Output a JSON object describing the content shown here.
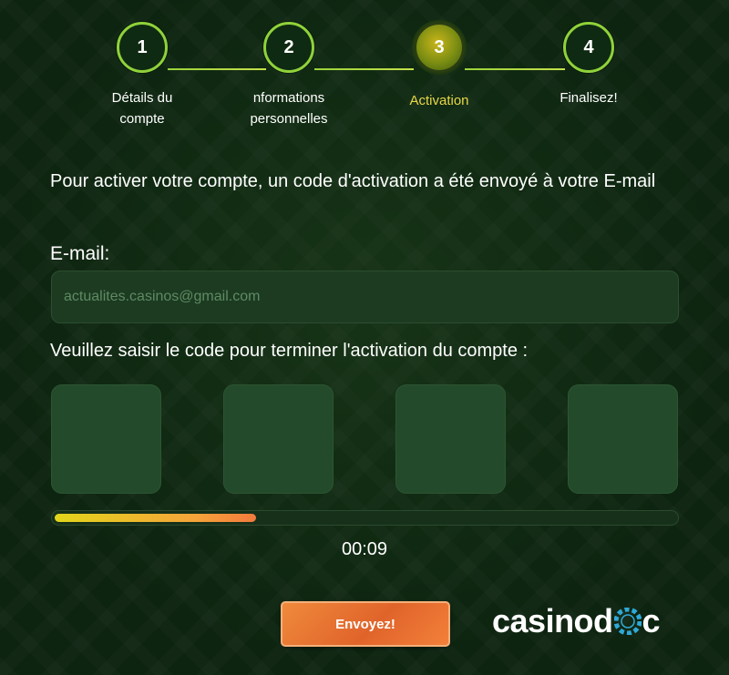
{
  "stepper": {
    "steps": [
      {
        "number": "1",
        "label_line1": "Détails du",
        "label_line2": "compte",
        "state": "completed"
      },
      {
        "number": "2",
        "label_line1": "nformations",
        "label_line2": "personnelles",
        "state": "completed"
      },
      {
        "number": "3",
        "label_line1": "Activation",
        "label_line2": "",
        "state": "active"
      },
      {
        "number": "4",
        "label_line1": "Finalisez!",
        "label_line2": "",
        "state": "pending"
      }
    ]
  },
  "intro_text": "Pour activer votre compte, un code d'activation a été envoyé à votre E-mail",
  "email": {
    "label": "E-mail:",
    "value": "actualites.casinos@gmail.com"
  },
  "code": {
    "label": "Veuillez saisir le code pour terminer l'activation du compte :",
    "digits": [
      "",
      "",
      "",
      ""
    ]
  },
  "countdown": {
    "time": "00:09",
    "remaining_fraction": 0.33
  },
  "submit_label": "Envoyez!",
  "logo": {
    "text": "casinodoc",
    "text_part1": "casinod",
    "text_part2": "c"
  },
  "colors": {
    "accent_green": "#8fd23a",
    "active_step": "#e8d845",
    "button_orange": "#e8702f"
  }
}
